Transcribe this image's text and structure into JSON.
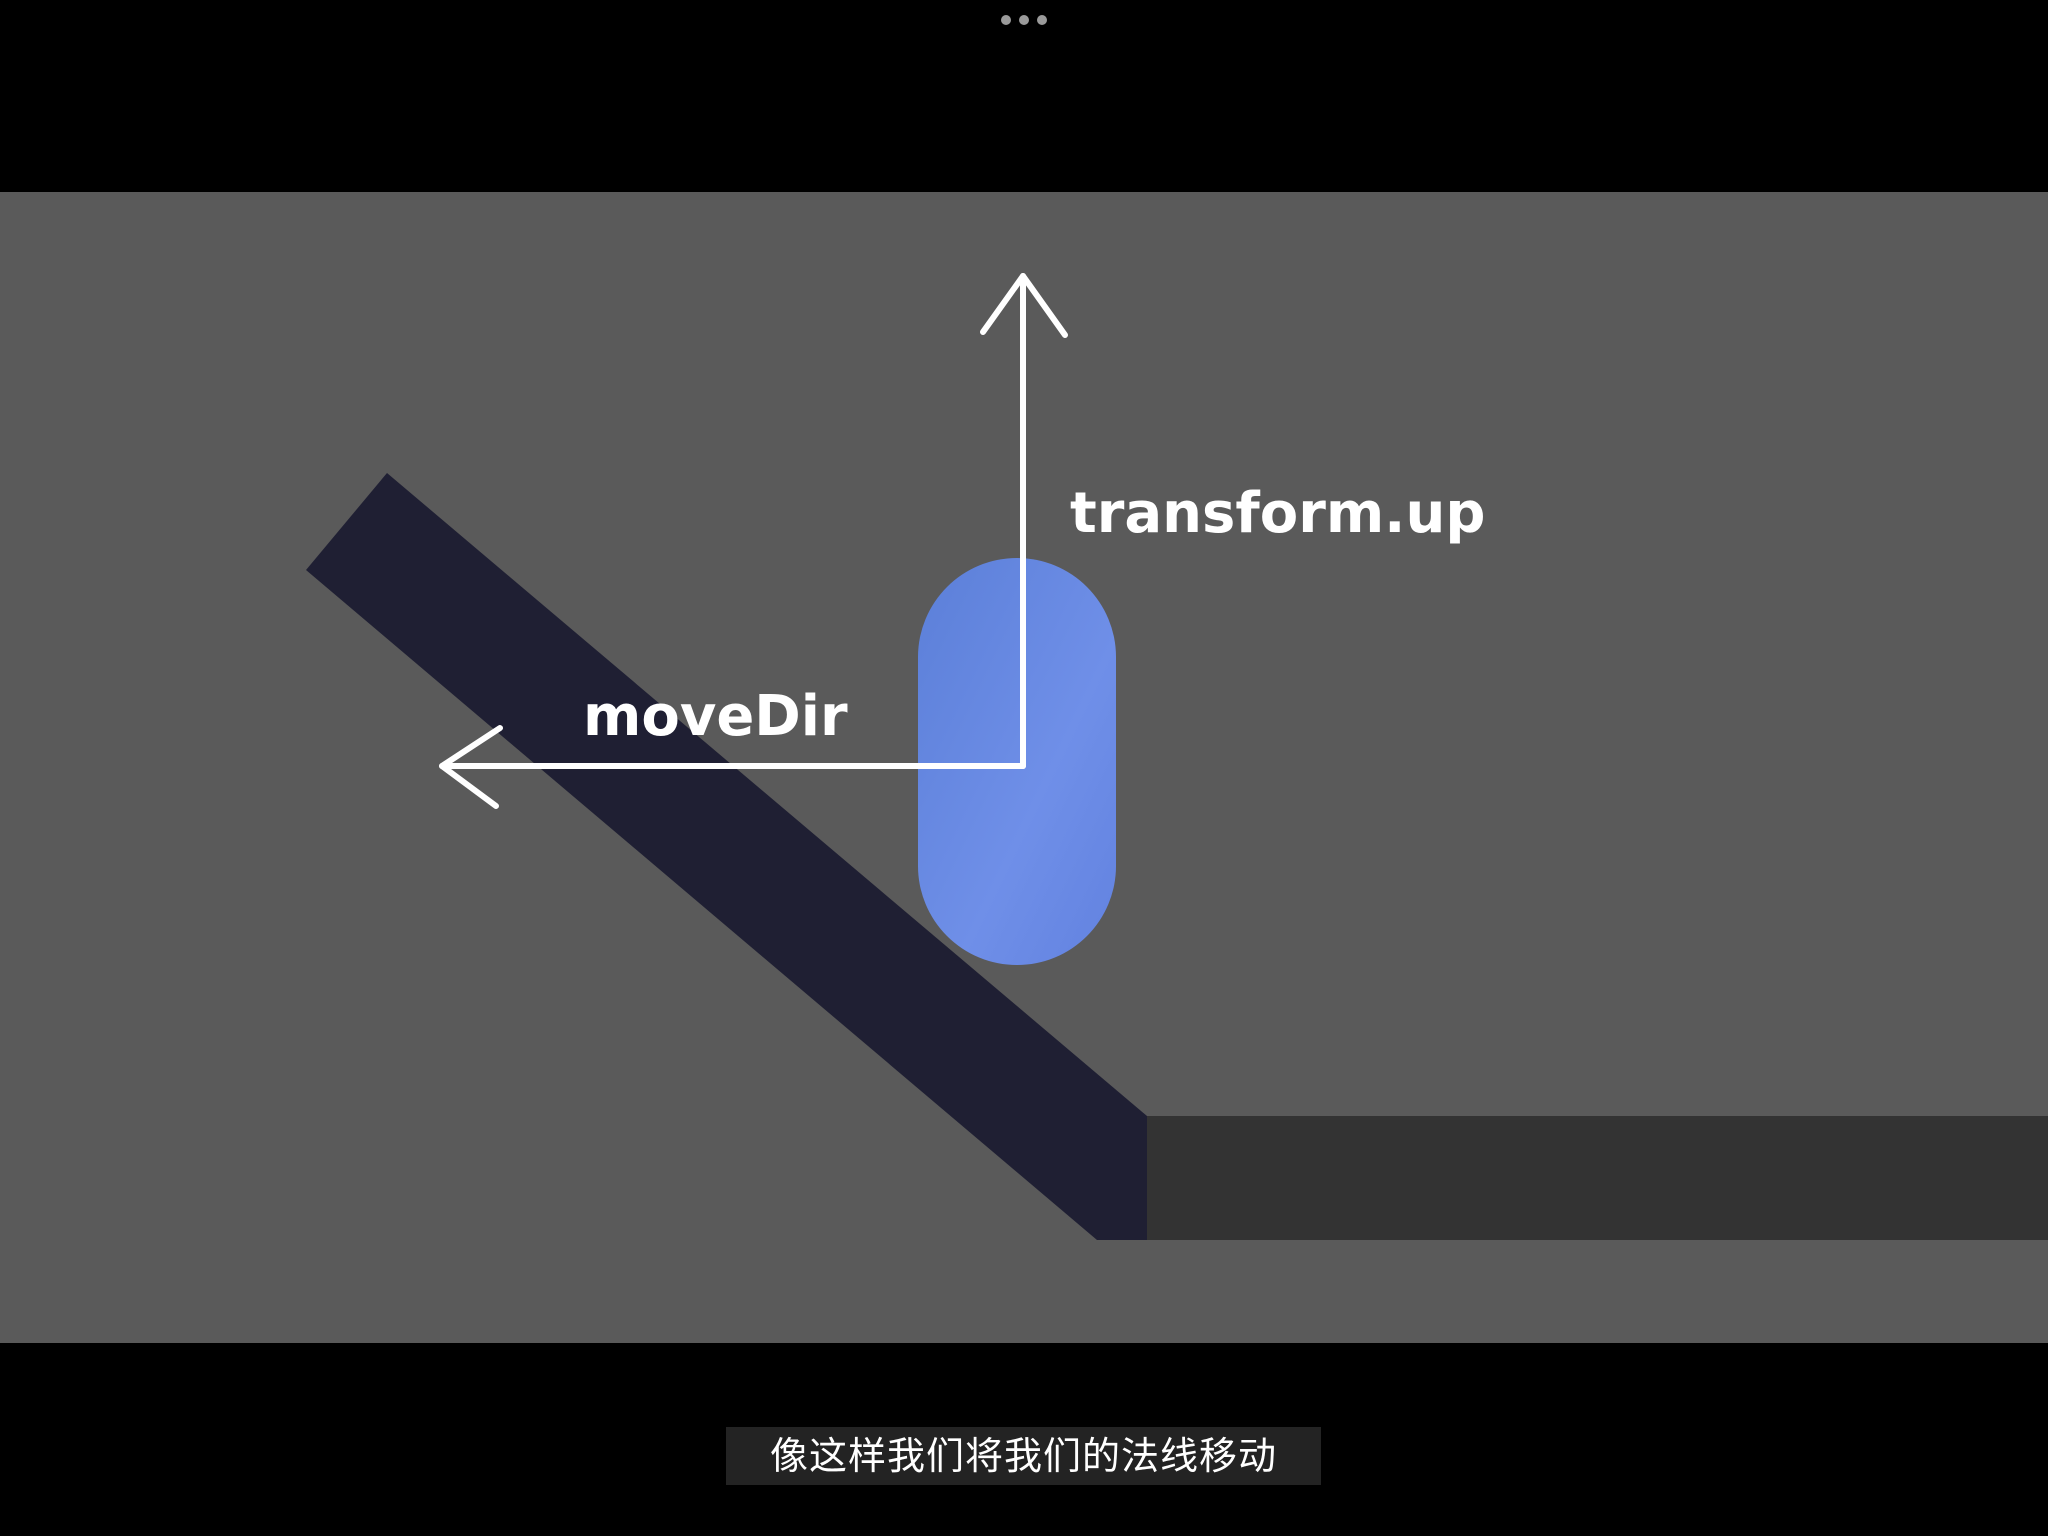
{
  "player": {
    "more_menu_icon": "more-horizontal-icon"
  },
  "scene": {
    "labels": {
      "up_vector": "transform.up",
      "move_direction": "moveDir"
    },
    "colors": {
      "background": "#5a5a5a",
      "ramp": "#1f1f33",
      "floor": "#333333",
      "capsule": "#6e8ee6",
      "arrow": "#ffffff"
    }
  },
  "subtitle": {
    "text": "像这样我们将我们的法线移动"
  }
}
